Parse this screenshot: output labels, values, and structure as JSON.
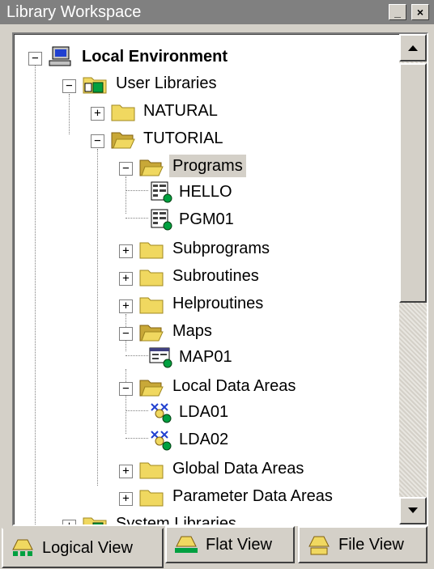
{
  "window": {
    "title": "Library Workspace",
    "minimize_label": "_",
    "close_label": "×"
  },
  "tree": {
    "root": "Local Environment",
    "user_libraries": "User Libraries",
    "natural": "NATURAL",
    "tutorial": "TUTORIAL",
    "programs": "Programs",
    "hello": "HELLO",
    "pgm01": "PGM01",
    "subprograms": "Subprograms",
    "subroutines": "Subroutines",
    "helproutines": "Helproutines",
    "maps": "Maps",
    "map01": "MAP01",
    "local_data_areas": "Local Data Areas",
    "lda01": "LDA01",
    "lda02": "LDA02",
    "global_data_areas": "Global Data Areas",
    "parameter_data_areas": "Parameter Data Areas",
    "system_libraries": "System Libraries",
    "expand_symbol": "+",
    "collapse_symbol": "−"
  },
  "tabs": {
    "logical": "Logical View",
    "flat": "Flat View",
    "file": "File View"
  },
  "colors": {
    "folder": "#f0d860",
    "folder_dark": "#a08820",
    "lib_green": "#00a040",
    "lda_blue": "#2040d0"
  }
}
